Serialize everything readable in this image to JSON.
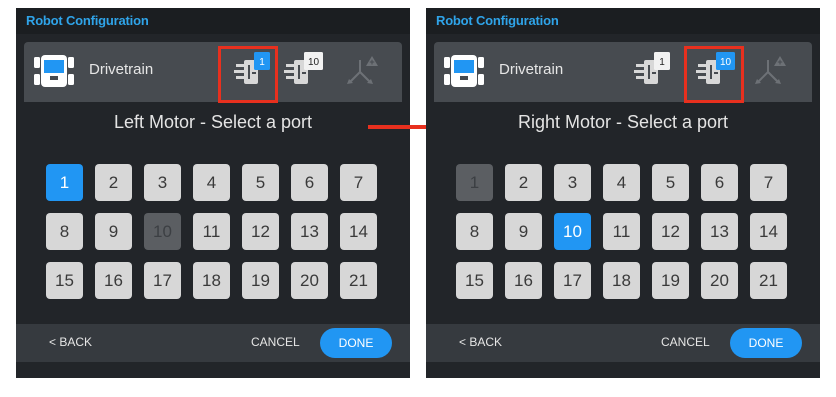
{
  "colors": {
    "accent": "#2196f3",
    "title": "#2fa4e9",
    "highlight": "#e8301e",
    "panel_bg": "#222529",
    "device_bar": "#474b50",
    "port_default": "#d7d7d7",
    "port_disabled": "#5b5e62"
  },
  "icons": [
    "drivetrain-icon",
    "motor-port-icon",
    "gyro-sensor-icon",
    "arrow-right-icon"
  ],
  "screens": [
    {
      "title": "Robot Configuration",
      "device_label": "Drivetrain",
      "motors": [
        {
          "port_badge": "1",
          "active": true
        },
        {
          "port_badge": "10",
          "active": false
        }
      ],
      "highlighted_motor": 0,
      "prompt": "Left Motor - Select a port",
      "ports": [
        "1",
        "2",
        "3",
        "4",
        "5",
        "6",
        "7",
        "8",
        "9",
        "10",
        "11",
        "12",
        "13",
        "14",
        "15",
        "16",
        "17",
        "18",
        "19",
        "20",
        "21"
      ],
      "selected_port": "1",
      "disabled_port": "10",
      "back_label": "< BACK",
      "cancel_label": "CANCEL",
      "done_label": "DONE"
    },
    {
      "title": "Robot Configuration",
      "device_label": "Drivetrain",
      "motors": [
        {
          "port_badge": "1",
          "active": false
        },
        {
          "port_badge": "10",
          "active": true
        }
      ],
      "highlighted_motor": 1,
      "prompt": "Right Motor - Select a port",
      "ports": [
        "1",
        "2",
        "3",
        "4",
        "5",
        "6",
        "7",
        "8",
        "9",
        "10",
        "11",
        "12",
        "13",
        "14",
        "15",
        "16",
        "17",
        "18",
        "19",
        "20",
        "21"
      ],
      "selected_port": "10",
      "disabled_port": "1",
      "back_label": "< BACK",
      "cancel_label": "CANCEL",
      "done_label": "DONE"
    }
  ]
}
